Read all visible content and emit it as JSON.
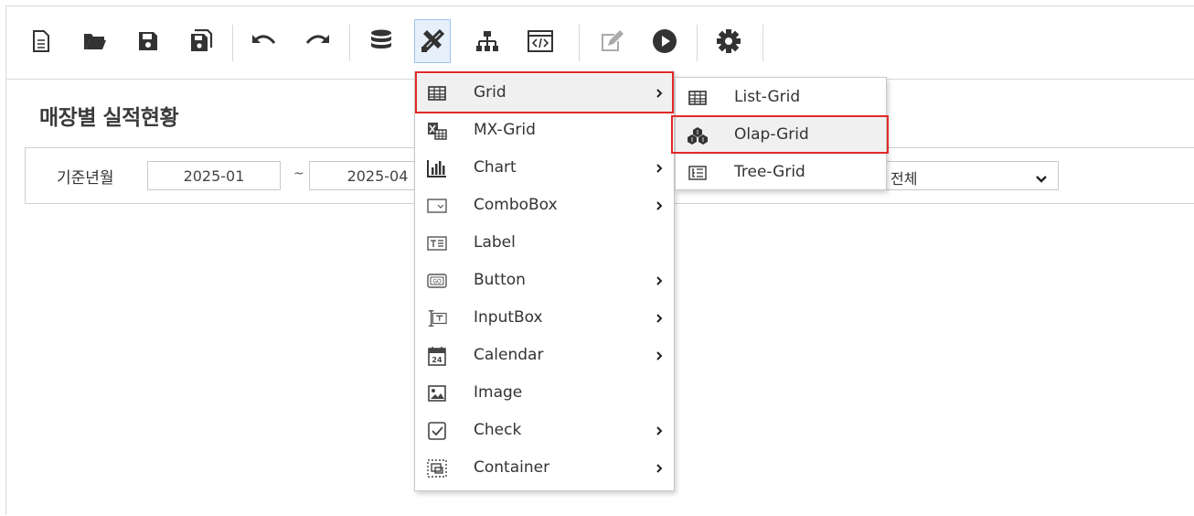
{
  "toolbar": {
    "buttons": [
      {
        "icon": "new-file-icon"
      },
      {
        "icon": "open-folder-icon"
      },
      {
        "icon": "save-icon"
      },
      {
        "icon": "save-as-icon"
      },
      {
        "icon": "undo-icon"
      },
      {
        "icon": "redo-icon"
      },
      {
        "icon": "database-icon"
      },
      {
        "icon": "tools-icon",
        "active": true
      },
      {
        "icon": "hierarchy-icon"
      },
      {
        "icon": "code-window-icon"
      },
      {
        "icon": "edit-icon",
        "disabled": true
      },
      {
        "icon": "run-icon"
      },
      {
        "icon": "settings-icon"
      }
    ]
  },
  "page": {
    "title": "매장별 실적현황",
    "filter": {
      "label": "기준년월",
      "from": "2025-01",
      "separator": "~",
      "to": "2025-04",
      "select_value": "전체"
    }
  },
  "component_menu": {
    "items": [
      {
        "label": "Grid",
        "icon": "grid-icon",
        "submenu": true,
        "highlighted": true
      },
      {
        "label": "MX-Grid",
        "icon": "mx-grid-icon",
        "submenu": false
      },
      {
        "label": "Chart",
        "icon": "chart-icon",
        "submenu": true
      },
      {
        "label": "ComboBox",
        "icon": "combobox-icon",
        "submenu": true
      },
      {
        "label": "Label",
        "icon": "label-icon",
        "submenu": false
      },
      {
        "label": "Button",
        "icon": "button-icon",
        "submenu": true
      },
      {
        "label": "InputBox",
        "icon": "inputbox-icon",
        "submenu": true
      },
      {
        "label": "Calendar",
        "icon": "calendar-icon",
        "submenu": true
      },
      {
        "label": "Image",
        "icon": "image-icon",
        "submenu": false
      },
      {
        "label": "Check",
        "icon": "check-icon",
        "submenu": true
      },
      {
        "label": "Container",
        "icon": "container-icon",
        "submenu": true
      }
    ]
  },
  "grid_submenu": {
    "items": [
      {
        "label": "List-Grid",
        "icon": "list-grid-icon"
      },
      {
        "label": "Olap-Grid",
        "icon": "olap-grid-icon",
        "highlighted": true
      },
      {
        "label": "Tree-Grid",
        "icon": "tree-grid-icon"
      }
    ]
  },
  "colors": {
    "highlight_border": "#e02929",
    "active_tool_bg": "#e6f0fb",
    "icon": "#333333"
  }
}
